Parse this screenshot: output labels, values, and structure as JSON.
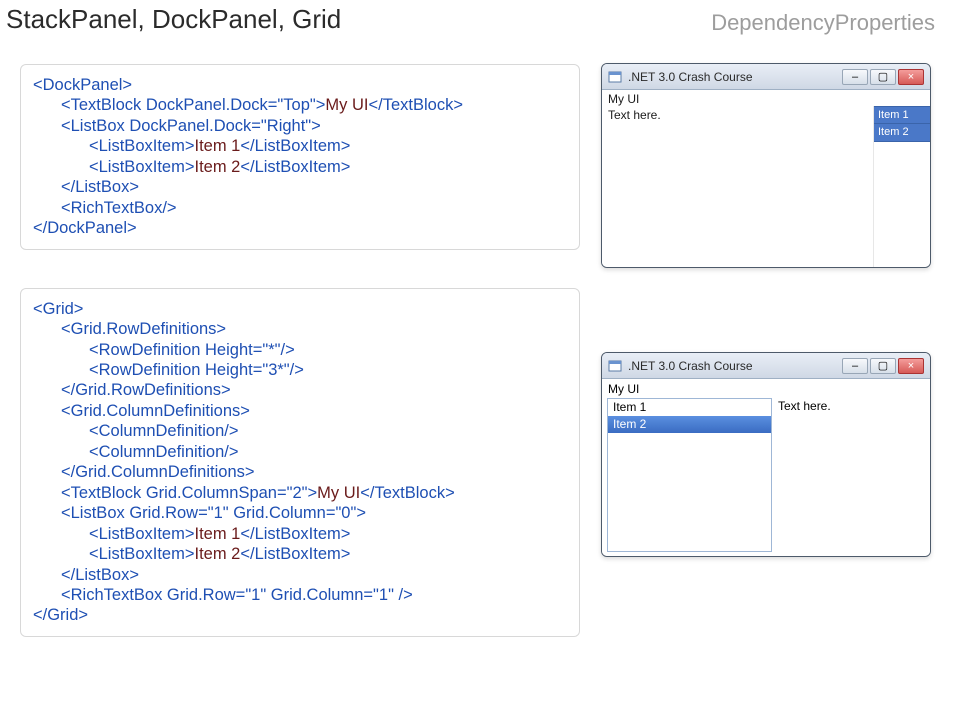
{
  "header": {
    "title": "StackPanel, DockPanel, Grid",
    "subtitle": "DependencyProperties"
  },
  "code1": {
    "l0_a": "<DockPanel>",
    "l1_a": "<TextBlock DockPanel.Dock=\"Top\">",
    "l1_t": "My UI",
    "l1_b": "</TextBlock>",
    "l2_a": "<ListBox DockPanel.Dock=\"Right\">",
    "l3_a": "<ListBoxItem>",
    "l3_t": "Item 1",
    "l3_b": "</ListBoxItem>",
    "l4_a": "<ListBoxItem>",
    "l4_t": "Item 2",
    "l4_b": "</ListBoxItem>",
    "l5_a": "</ListBox>",
    "l6_a": "<RichTextBox/>",
    "l7_a": "</DockPanel>"
  },
  "code2": {
    "l0": "<Grid>",
    "l1": "<Grid.RowDefinitions>",
    "l2": "<RowDefinition Height=\"*\"/>",
    "l3": "<RowDefinition Height=\"3*\"/>",
    "l4": "</Grid.RowDefinitions>",
    "l5": "<Grid.ColumnDefinitions>",
    "l6": "<ColumnDefinition/>",
    "l7": "<ColumnDefinition/>",
    "l8": "</Grid.ColumnDefinitions>",
    "l9_a": "<TextBlock Grid.ColumnSpan=\"2\">",
    "l9_t": "My UI",
    "l9_b": "</TextBlock>",
    "l10": "<ListBox Grid.Row=\"1\" Grid.Column=\"0\">",
    "l11_a": "<ListBoxItem>",
    "l11_t": "Item 1",
    "l11_b": "</ListBoxItem>",
    "l12_a": "<ListBoxItem>",
    "l12_t": "Item 2",
    "l12_b": "</ListBoxItem>",
    "l13": "</ListBox>",
    "l14": "<RichTextBox Grid.Row=\"1\" Grid.Column=\"1\" />",
    "l15": "</Grid>"
  },
  "window": {
    "title": ".NET 3.0 Crash Course",
    "myui": "My UI",
    "texthere": "Text here.",
    "item1": "Item 1",
    "item2": "Item 2"
  }
}
